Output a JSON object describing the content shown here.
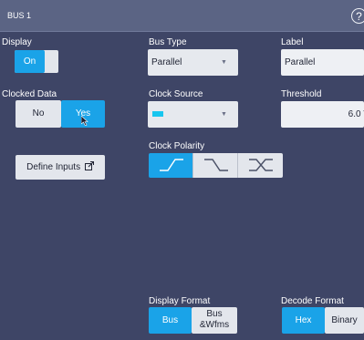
{
  "title": "BUS 1",
  "help_icon": "?",
  "display": {
    "label": "Display",
    "on_label": "On"
  },
  "bus_type": {
    "label": "Bus Type",
    "value": "Parallel"
  },
  "label_field": {
    "label": "Label",
    "value": "Parallel"
  },
  "clocked_data": {
    "label": "Clocked Data",
    "no_label": "No",
    "yes_label": "Yes",
    "selected": "Yes"
  },
  "clock_source": {
    "label": "Clock Source",
    "swatch_color": "#18c6ef"
  },
  "threshold": {
    "label": "Threshold",
    "value": "6.0 V"
  },
  "clock_polarity": {
    "label": "Clock Polarity",
    "options": [
      "rising-edge",
      "falling-edge",
      "either-edge"
    ],
    "selected": "rising-edge"
  },
  "define_inputs": {
    "label": "Define Inputs"
  },
  "display_format": {
    "label": "Display Format",
    "bus_label": "Bus",
    "bus_wfms_line1": "Bus",
    "bus_wfms_line2": "&Wfms",
    "selected": "Bus"
  },
  "decode_format": {
    "label": "Decode Format",
    "hex_label": "Hex",
    "binary_label": "Binary",
    "selected": "Hex"
  },
  "colors": {
    "accent": "#1aa3e8",
    "panel": "#3e4566",
    "title_bar": "#5b6484"
  }
}
